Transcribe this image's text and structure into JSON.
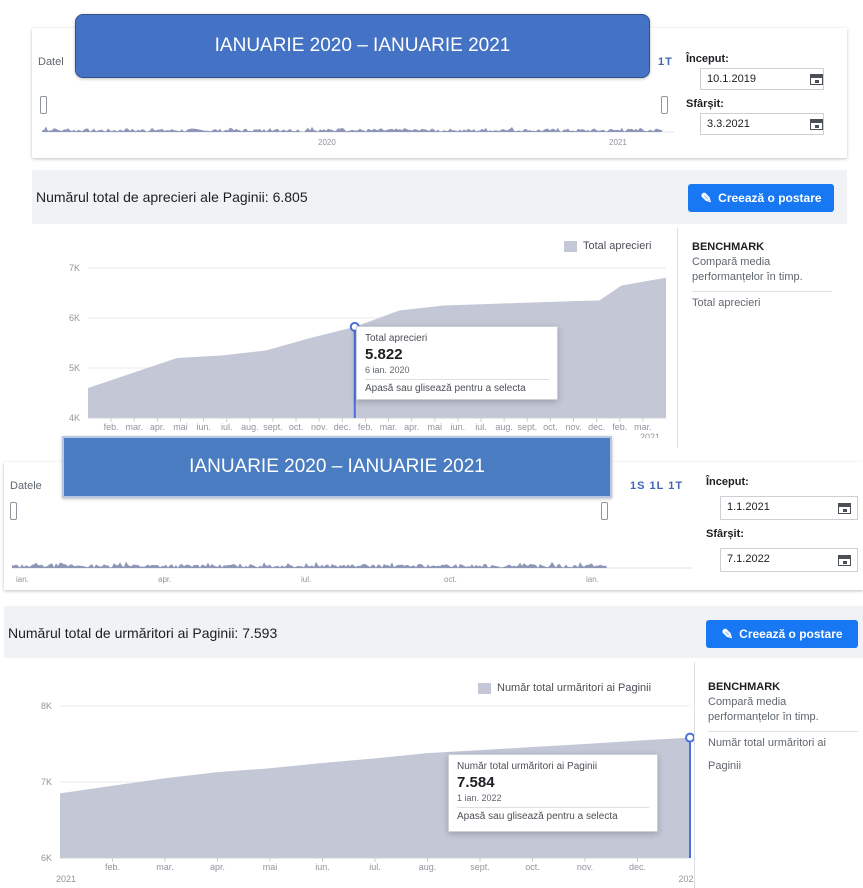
{
  "top": {
    "banner": "IANUARIE 2020 – IANUARIE 2021",
    "date_label_fragment": "Datel",
    "periods": "1T",
    "start_label": "Început:",
    "start_value": "10.1.2019",
    "end_label": "Sfârșit:",
    "end_value": "3.3.2021",
    "timeline_years": [
      "2020",
      "2021"
    ],
    "header_title": "Numărul total de aprecieri ale Paginii: 6.805",
    "create_post": "Creează o postare",
    "legend": "Total aprecieri",
    "y_ticks": [
      "7K",
      "6K",
      "5K",
      "4K"
    ],
    "x_months": [
      "feb.",
      "mar.",
      "apr.",
      "mai",
      "iun.",
      "iul.",
      "aug.",
      "sept.",
      "oct.",
      "nov.",
      "dec.",
      "feb.",
      "mar.",
      "apr.",
      "mai",
      "iun.",
      "iul.",
      "aug.",
      "sept.",
      "oct.",
      "nov.",
      "dec.",
      "feb.",
      "mar."
    ],
    "x_year": "2021",
    "tooltip": {
      "title": "Total aprecieri",
      "value": "5.822",
      "date": "6 ian. 2020",
      "hint": "Apasă sau glisează pentru a selecta"
    },
    "benchmark": {
      "heading": "BENCHMARK",
      "line1": "Compară media",
      "line2": "performanțelor în timp.",
      "metric": "Total aprecieri"
    }
  },
  "bottom": {
    "banner": "IANUARIE 2020 – IANUARIE 2021",
    "date_label_fragment": "Datele",
    "periods": "1S 1L 1T",
    "start_label": "Început:",
    "start_value": "1.1.2021",
    "end_label": "Sfârșit:",
    "end_value": "7.1.2022",
    "timeline_months": [
      "ian.",
      "apr.",
      "iul.",
      "oct.",
      "ian."
    ],
    "header_title": "Numărul total de urmăritori ai Paginii: 7.593",
    "create_post": "Creează o postare",
    "legend": "Număr total urmăritori ai Paginii",
    "y_ticks": [
      "8K",
      "7K",
      "6K"
    ],
    "x_months": [
      "feb.",
      "mar.",
      "apr.",
      "mai",
      "iun.",
      "iul.",
      "aug.",
      "sept.",
      "oct.",
      "nov.",
      "dec."
    ],
    "x_year_left": "2021",
    "x_year_right": "202",
    "tooltip": {
      "title": "Număr total urmăritori ai Paginii",
      "value": "7.584",
      "date": "1 ian. 2022",
      "hint": "Apasă sau glisează pentru a selecta"
    },
    "benchmark": {
      "heading": "BENCHMARK",
      "line1": "Compară media",
      "line2": "performanțelor în timp.",
      "metric1": "Număr total urmăritori ai",
      "metric2": "Paginii"
    }
  },
  "colors": {
    "accent": "#1877f2",
    "banner_top": "#4472c4",
    "banner_bottom": "#4a7cc1",
    "area_fill": "#c3c7d6",
    "line": "#4a6fd8"
  },
  "chart_data": [
    {
      "type": "area",
      "title": "Numărul total de aprecieri ale Paginii: 6.805",
      "series": [
        {
          "name": "Total aprecieri",
          "x": [
            "2019-01",
            "2019-03",
            "2019-05",
            "2019-07",
            "2019-09",
            "2019-11",
            "2020-01",
            "2020-03",
            "2020-05",
            "2020-07",
            "2020-09",
            "2020-11",
            "2020-12",
            "2021-01",
            "2021-03"
          ],
          "values": [
            4600,
            4900,
            5200,
            5250,
            5350,
            5600,
            5822,
            6150,
            6250,
            6280,
            6310,
            6340,
            6350,
            6650,
            6805
          ]
        }
      ],
      "ylim": [
        4000,
        7000
      ],
      "highlight": {
        "date": "6 ian. 2020",
        "value": 5822
      }
    },
    {
      "type": "area",
      "title": "Numărul total de urmăritori ai Paginii: 7.593",
      "series": [
        {
          "name": "Număr total urmăritori ai Paginii",
          "x": [
            "2021-01",
            "2021-02",
            "2021-03",
            "2021-04",
            "2021-05",
            "2021-06",
            "2021-07",
            "2021-08",
            "2021-09",
            "2021-10",
            "2021-11",
            "2021-12",
            "2022-01"
          ],
          "values": [
            6850,
            6950,
            7050,
            7130,
            7180,
            7250,
            7310,
            7380,
            7420,
            7460,
            7500,
            7545,
            7584
          ]
        }
      ],
      "ylim": [
        6000,
        8000
      ],
      "highlight": {
        "date": "1 ian. 2022",
        "value": 7584
      }
    }
  ]
}
